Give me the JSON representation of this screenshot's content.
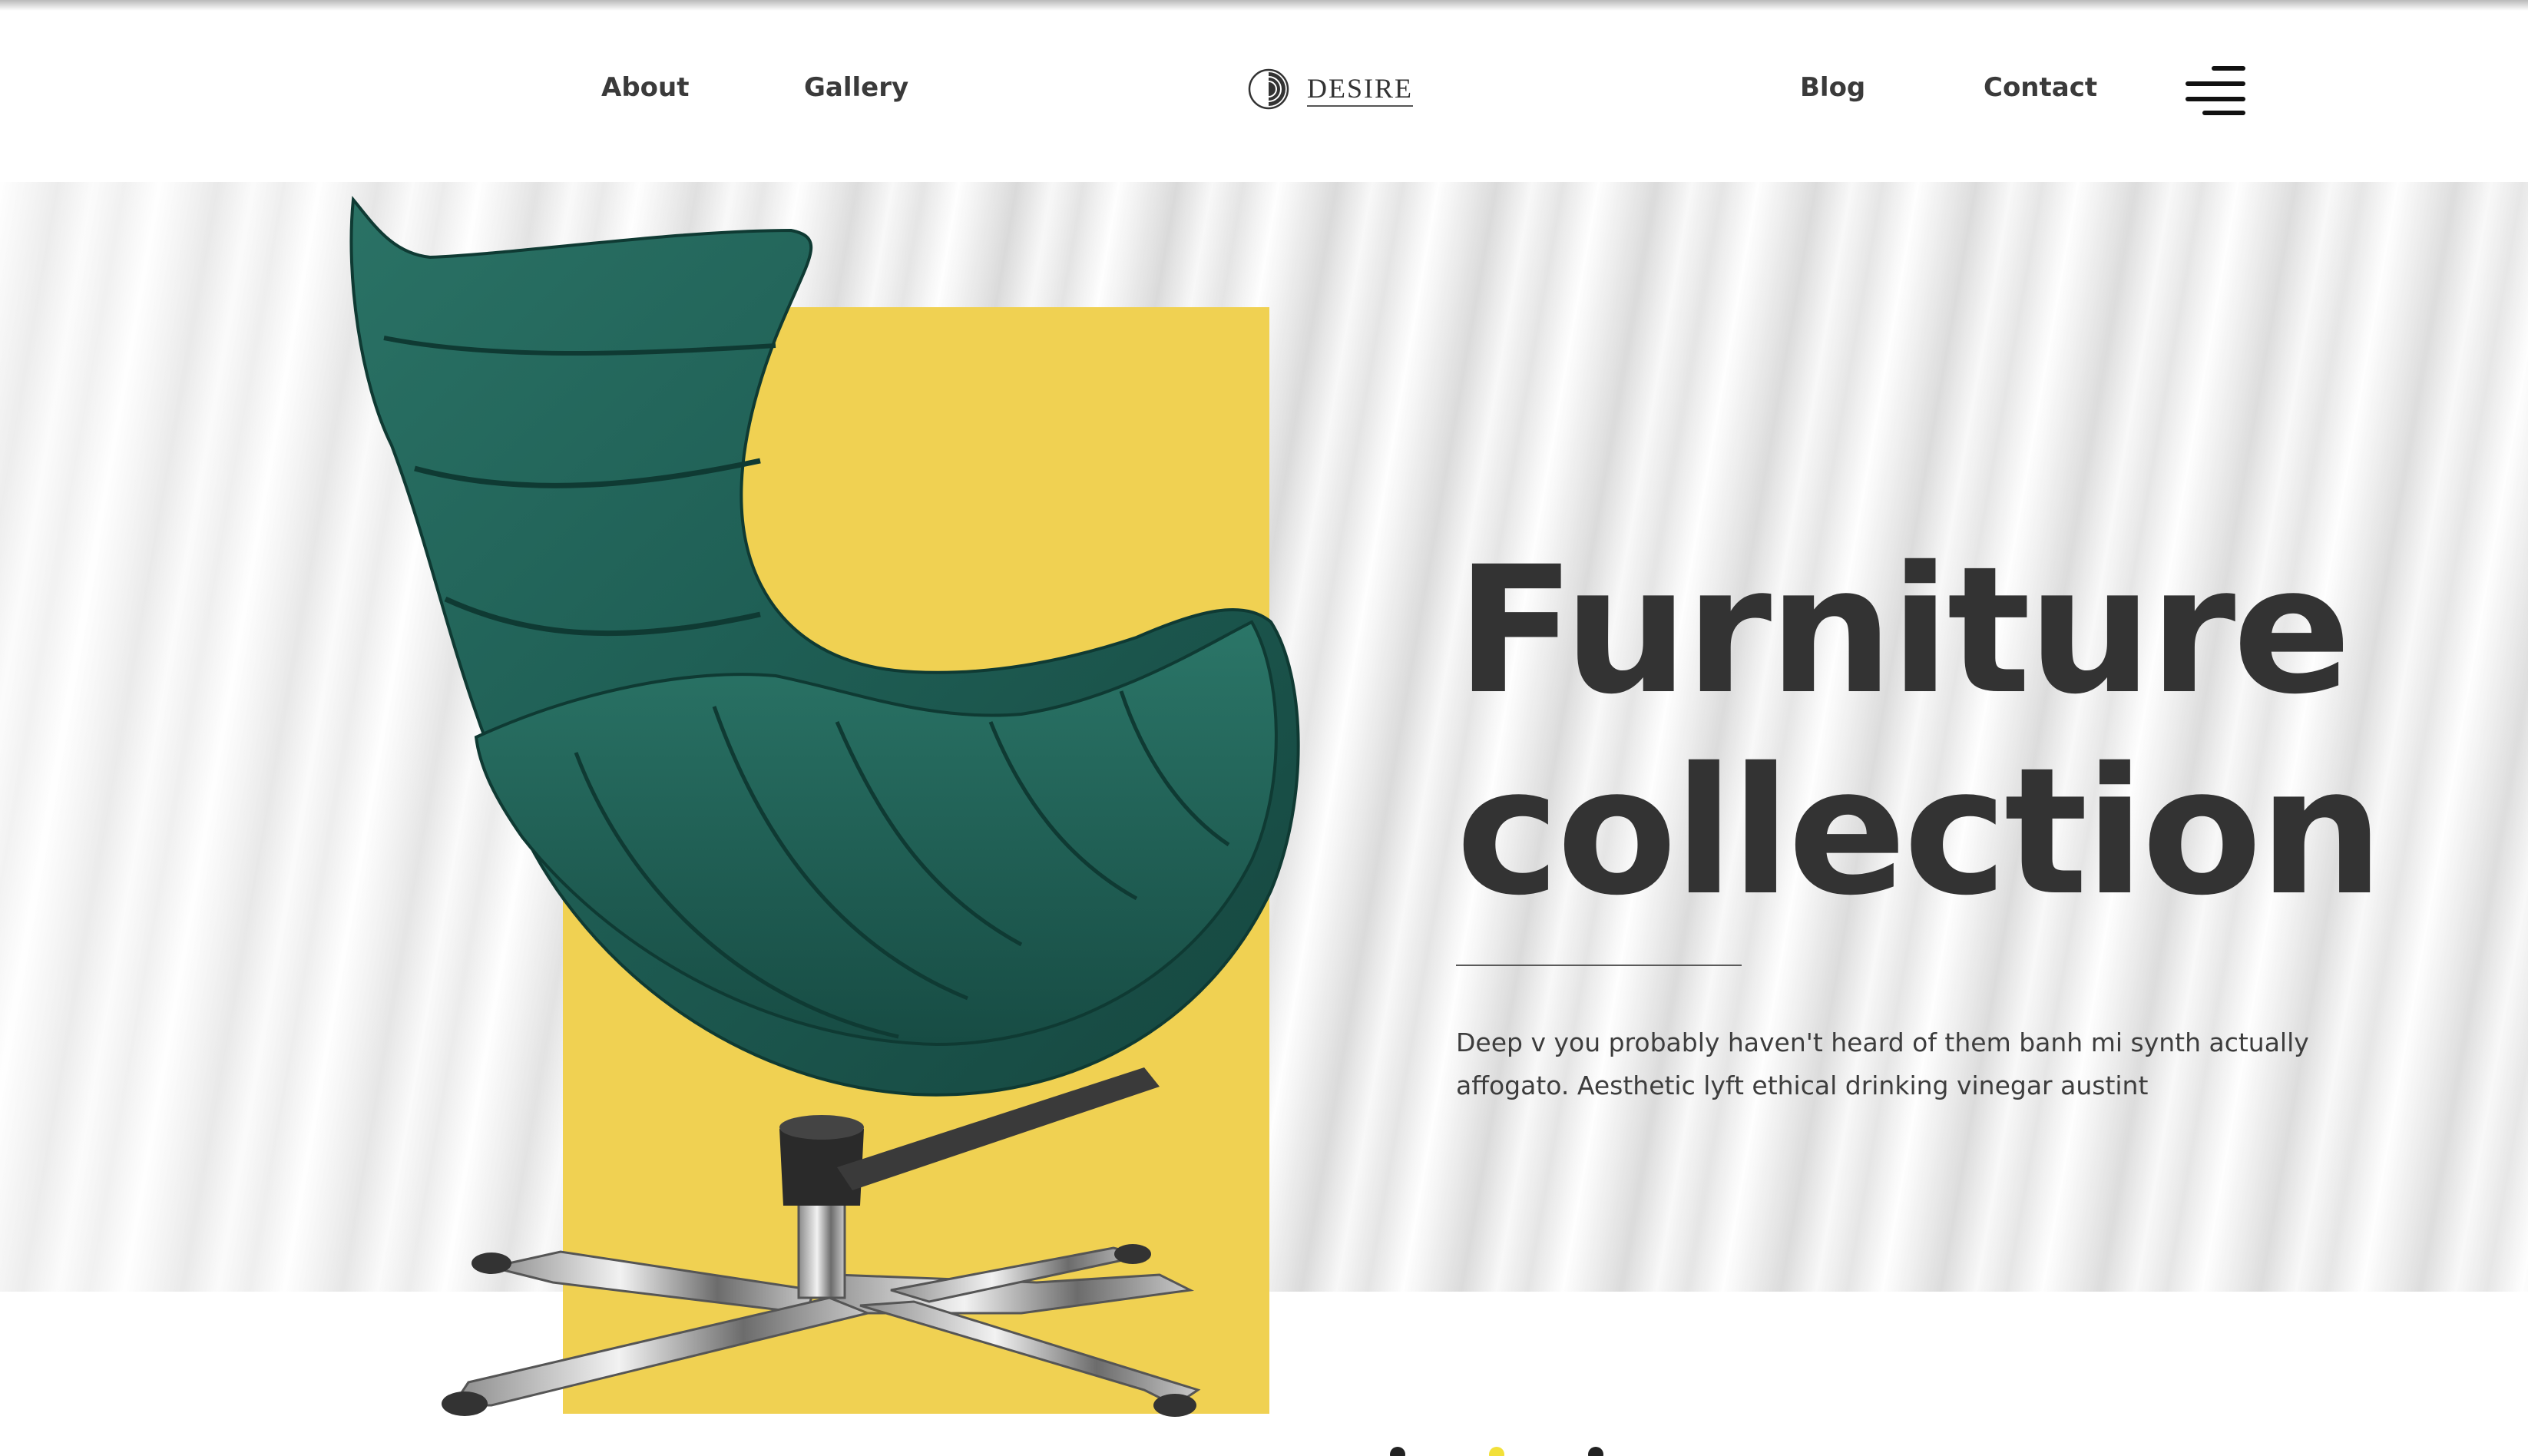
{
  "header": {
    "nav_left": [
      {
        "label": "About"
      },
      {
        "label": "Gallery"
      }
    ],
    "nav_right": [
      {
        "label": "Blog"
      },
      {
        "label": "Contact"
      }
    ],
    "logo": {
      "text": "DESIRE",
      "icon": "half-circle-logo-icon"
    },
    "menu_icon": "hamburger-menu-icon"
  },
  "hero": {
    "title_line1": "Furniture",
    "title_line2": "collection",
    "description": "Deep v you probably haven't heard of them banh mi synth actually affogato. Aesthetic lyft ethical drinking vinegar austint",
    "image": "green-leather-lounge-chair",
    "accent_color": "#f0d152",
    "chair_color": "#1f5f55"
  },
  "slider": {
    "slide_count": 3,
    "active_index": 1,
    "active_color": "#f2e03a",
    "inactive_color": "#222222"
  }
}
